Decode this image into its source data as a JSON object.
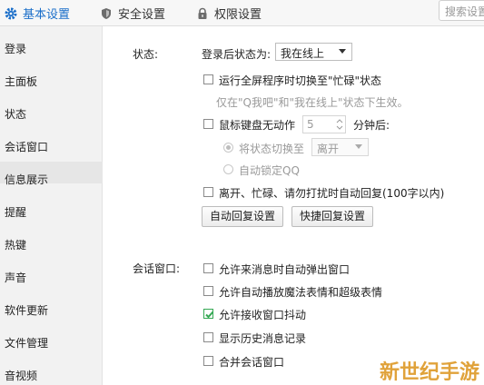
{
  "tabs": [
    {
      "label": "基本设置",
      "icon": "gear-icon"
    },
    {
      "label": "安全设置",
      "icon": "shield-icon"
    },
    {
      "label": "权限设置",
      "icon": "lock-icon"
    }
  ],
  "search": {
    "placeholder": "搜索设置"
  },
  "sidebar": {
    "items": [
      {
        "label": "登录"
      },
      {
        "label": "主面板"
      },
      {
        "label": "状态"
      },
      {
        "label": "会话窗口"
      },
      {
        "label": "信息展示"
      },
      {
        "label": "提醒"
      },
      {
        "label": "热键"
      },
      {
        "label": "声音"
      },
      {
        "label": "软件更新"
      },
      {
        "label": "文件管理"
      },
      {
        "label": "音视频"
      }
    ],
    "active": "会话窗口"
  },
  "status_section": {
    "heading": "状态:",
    "login_status_label": "登录后状态为:",
    "login_status_value": "我在线上",
    "fullscreen_busy": {
      "label": "运行全屏程序时切换至\"忙碌\"状态",
      "checked": false
    },
    "fullscreen_hint": "仅在\"Q我吧\"和\"我在线上\"状态下生效。",
    "idle": {
      "label": "鼠标键盘无动作",
      "checked": false,
      "minutes": "5",
      "suffix": "分钟后:"
    },
    "switch_status": {
      "label": "将状态切换至",
      "value": "离开",
      "selected": true
    },
    "auto_lock": {
      "label": "自动锁定QQ",
      "selected": false
    },
    "auto_reply": {
      "label": "离开、忙碌、请勿打扰时自动回复(100字以内)",
      "checked": false
    },
    "auto_reply_button": "自动回复设置",
    "quick_reply_button": "快捷回复设置"
  },
  "chat_section": {
    "heading": "会话窗口:",
    "options": [
      {
        "label": "允许来消息时自动弹出窗口",
        "checked": false
      },
      {
        "label": "允许自动播放魔法表情和超级表情",
        "checked": false
      },
      {
        "label": "允许接收窗口抖动",
        "checked": true
      },
      {
        "label": "显示历史消息记录",
        "checked": false
      },
      {
        "label": "合并会话窗口",
        "checked": false
      }
    ]
  },
  "watermark": "新世纪手游",
  "colors": {
    "accent": "#1a6ec9",
    "check": "#34a853"
  }
}
